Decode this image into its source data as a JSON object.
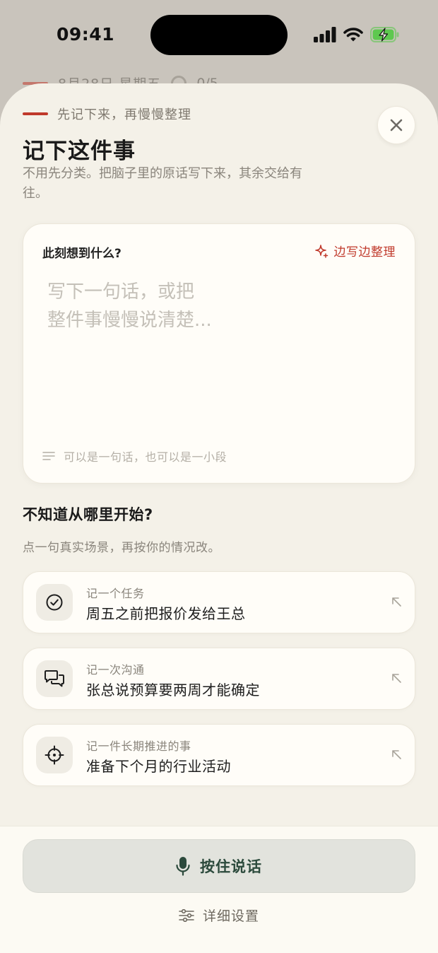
{
  "status_bar": {
    "time": "09:41"
  },
  "background_page": {
    "date": "8月28日 星期五",
    "progress": "0/5"
  },
  "sheet": {
    "eyebrow": "先记下来，再慢慢整理",
    "title": "记下这件事",
    "subtitle": "不用先分类。把脑子里的原话写下来，其余交给有往。",
    "close_icon": "close-icon"
  },
  "note_card": {
    "label": "此刻想到什么?",
    "organize_label": "边写边整理",
    "input_value": "",
    "input_placeholder": "写下一句话，或把\n整件事慢慢说清楚...",
    "hint": "可以是一句话，也可以是一小段"
  },
  "starters": {
    "title": "不知道从哪里开始?",
    "subtitle": "点一句真实场景，再按你的情况改。",
    "items": [
      {
        "kind": "记一个任务",
        "text": "周五之前把报价发给王总",
        "icon": "check-circle-icon"
      },
      {
        "kind": "记一次沟通",
        "text": "张总说预算要两周才能确定",
        "icon": "chat-bubbles-icon"
      },
      {
        "kind": "记一件长期推进的事",
        "text": "准备下个月的行业活动",
        "icon": "target-icon"
      }
    ]
  },
  "bottom_bar": {
    "talk_label": "按住说话",
    "settings_label": "详细设置"
  },
  "colors": {
    "accent": "#c0392b",
    "sheet_bg": "#f4f1e8",
    "card_bg": "#fffdf8",
    "talk_text": "#2c4a3c",
    "battery": "#5ec84f"
  }
}
